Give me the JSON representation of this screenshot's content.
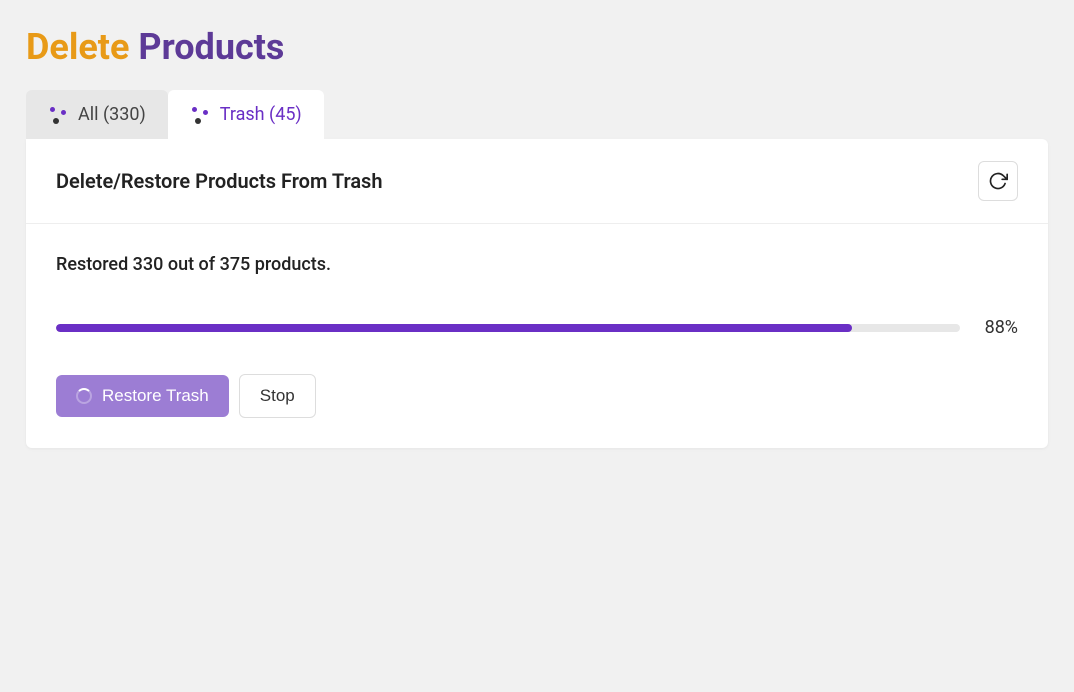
{
  "title": {
    "part1": "Delete",
    "part2": "Products"
  },
  "tabs": [
    {
      "label": "All (330)"
    },
    {
      "label": "Trash (45)"
    }
  ],
  "panel": {
    "header": "Delete/Restore Products From Trash"
  },
  "progress": {
    "restored_count": 330,
    "total_count": 375,
    "status_text": "Restored 330 out of 375 products.",
    "percent": 88,
    "percent_label": "88%"
  },
  "buttons": {
    "restore_label": "Restore Trash",
    "stop_label": "Stop"
  }
}
